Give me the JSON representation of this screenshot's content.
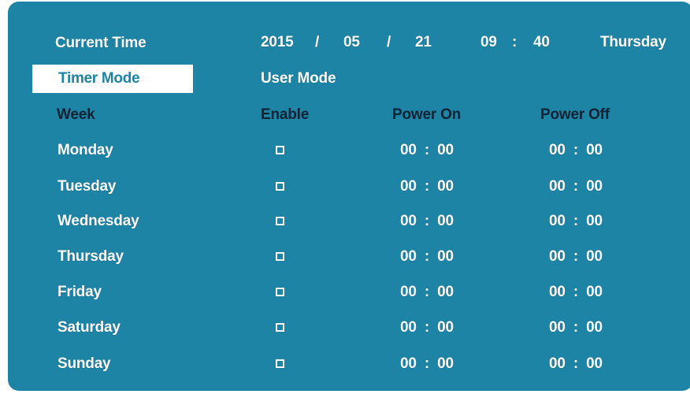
{
  "current_time": {
    "label": "Current Time",
    "year": "2015",
    "sep1": "/",
    "month": "05",
    "sep2": "/",
    "day": "21",
    "hour": "09",
    "colon": ":",
    "minute": "40",
    "weekday": "Thursday"
  },
  "modes": {
    "timer_mode": "Timer Mode",
    "user_mode": "User Mode"
  },
  "table": {
    "headers": {
      "week": "Week",
      "enable": "Enable",
      "power_on": "Power On",
      "power_off": "Power Off"
    },
    "rows": [
      {
        "day": "Monday",
        "enabled": false,
        "power_on": "00  :  00",
        "power_off": "00  :  00"
      },
      {
        "day": "Tuesday",
        "enabled": false,
        "power_on": "00  :  00",
        "power_off": "00  :  00"
      },
      {
        "day": "Wednesday",
        "enabled": false,
        "power_on": "00  :  00",
        "power_off": "00  :  00"
      },
      {
        "day": "Thursday",
        "enabled": false,
        "power_on": "00  :  00",
        "power_off": "00  :  00"
      },
      {
        "day": "Friday",
        "enabled": false,
        "power_on": "00  :  00",
        "power_off": "00  :  00"
      },
      {
        "day": "Saturday",
        "enabled": false,
        "power_on": "00  :  00",
        "power_off": "00  :  00"
      },
      {
        "day": "Sunday",
        "enabled": false,
        "power_on": "00  :  00",
        "power_off": "00  :  00"
      }
    ]
  },
  "colors": {
    "panel_bg": "#1d84a6",
    "text": "#ffffff",
    "header_text": "#0d2233",
    "highlight_bg": "#ffffff"
  }
}
